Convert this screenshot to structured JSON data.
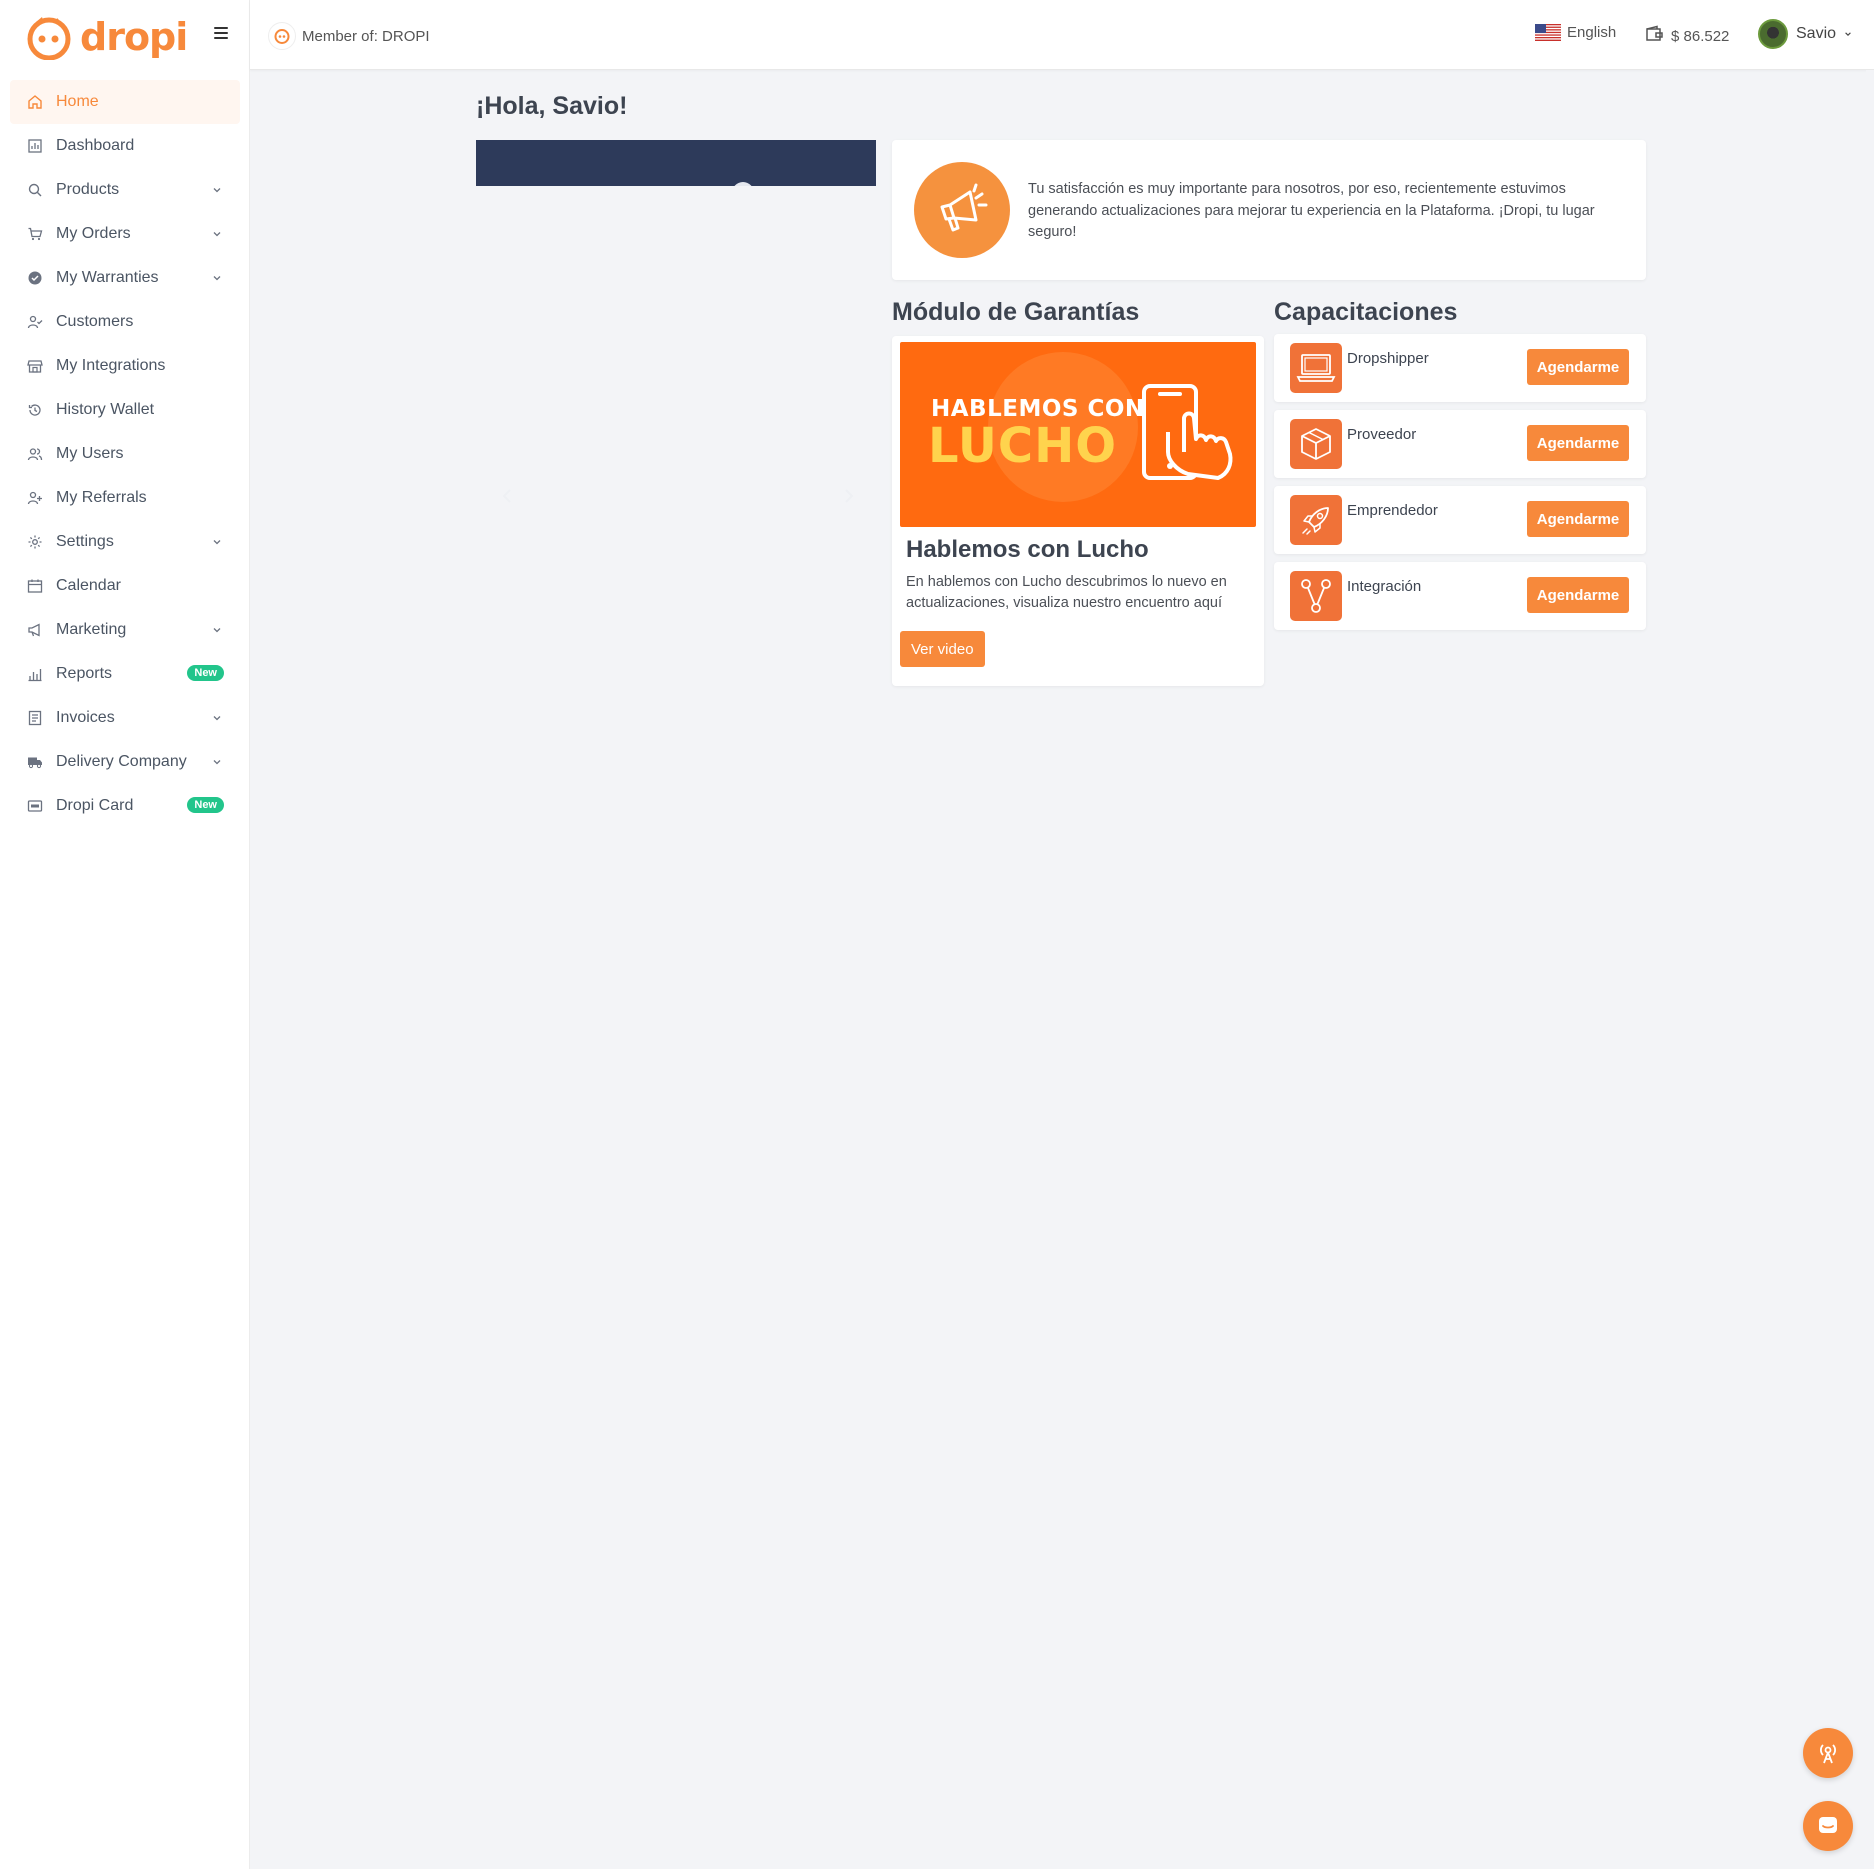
{
  "brand": {
    "name": "dropi",
    "accent": "#f7893b"
  },
  "topbar": {
    "member_label": "Member of: DROPI",
    "language": "English",
    "wallet_balance": "$ 86.522",
    "user_name": "Savio"
  },
  "sidebar": {
    "items": [
      {
        "label": "Home",
        "icon": "home-icon",
        "active": true
      },
      {
        "label": "Dashboard",
        "icon": "dashboard-icon"
      },
      {
        "label": "Products",
        "icon": "search-icon",
        "expandable": true
      },
      {
        "label": "My Orders",
        "icon": "cart-icon",
        "expandable": true
      },
      {
        "label": "My Warranties",
        "icon": "shield-check-icon",
        "expandable": true
      },
      {
        "label": "Customers",
        "icon": "user-check-icon"
      },
      {
        "label": "My Integrations",
        "icon": "store-icon"
      },
      {
        "label": "History Wallet",
        "icon": "history-icon"
      },
      {
        "label": "My Users",
        "icon": "users-icon"
      },
      {
        "label": "My Referrals",
        "icon": "user-plus-icon"
      },
      {
        "label": "Settings",
        "icon": "gear-icon",
        "expandable": true
      },
      {
        "label": "Calendar",
        "icon": "calendar-icon"
      },
      {
        "label": "Marketing",
        "icon": "megaphone-icon",
        "expandable": true
      },
      {
        "label": "Reports",
        "icon": "bar-chart-icon",
        "badge": "New"
      },
      {
        "label": "Invoices",
        "icon": "invoice-icon",
        "expandable": true
      },
      {
        "label": "Delivery Company",
        "icon": "truck-icon",
        "expandable": true
      },
      {
        "label": "Dropi Card",
        "icon": "card-icon",
        "badge": "New"
      }
    ]
  },
  "main": {
    "greeting": "¡Hola, Savio!",
    "notice_text": "Tu satisfacción es muy importante para nosotros, por eso, recientemente estuvimos generando actualizaciones para mejorar tu experiencia en la Plataforma. ¡Dropi, tu lugar seguro!",
    "garantias": {
      "section_title": "Módulo de Garantías",
      "banner_line1": "HABLEMOS CON",
      "banner_line2": "LUCHO",
      "card_title": "Hablemos con Lucho",
      "card_desc": "En hablemos con Lucho descubrimos lo nuevo en actualizaciones, visualiza nuestro encuentro aquí",
      "button": "Ver video"
    },
    "capacitaciones": {
      "section_title": "Capacitaciones",
      "items": [
        {
          "label": "Dropshipper",
          "icon": "laptop-icon",
          "button": "Agendarme"
        },
        {
          "label": "Proveedor",
          "icon": "box-icon",
          "button": "Agendarme"
        },
        {
          "label": "Emprendedor",
          "icon": "rocket-icon",
          "button": "Agendarme"
        },
        {
          "label": "Integración",
          "icon": "share-nodes-icon",
          "button": "Agendarme"
        }
      ]
    }
  }
}
